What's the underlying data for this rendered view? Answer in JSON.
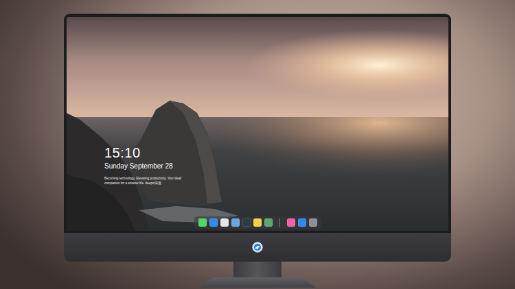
{
  "lock_screen": {
    "time": "15:10",
    "date": "Sunday September 28",
    "tagline": "Becoming technology, Elevating productivity. Your ideal companion for a smarter life. deepin深度"
  },
  "dock": {
    "items": [
      {
        "kind": "app",
        "color": "#4cd964"
      },
      {
        "kind": "app",
        "color": "#2f8cf0"
      },
      {
        "kind": "app",
        "color": "#e6e6e6"
      },
      {
        "kind": "app",
        "color": "#6aa7e0"
      },
      {
        "kind": "app",
        "color": "#2e3a46"
      },
      {
        "kind": "app",
        "color": "#f6d04d"
      },
      {
        "kind": "app",
        "color": "#5aa86a"
      },
      {
        "kind": "divider",
        "color": "#8a8a8e"
      },
      {
        "kind": "app",
        "color": "#f05fa8"
      },
      {
        "kind": "app",
        "color": "#2a8bf2"
      },
      {
        "kind": "app",
        "color": "#8e9096"
      }
    ]
  }
}
